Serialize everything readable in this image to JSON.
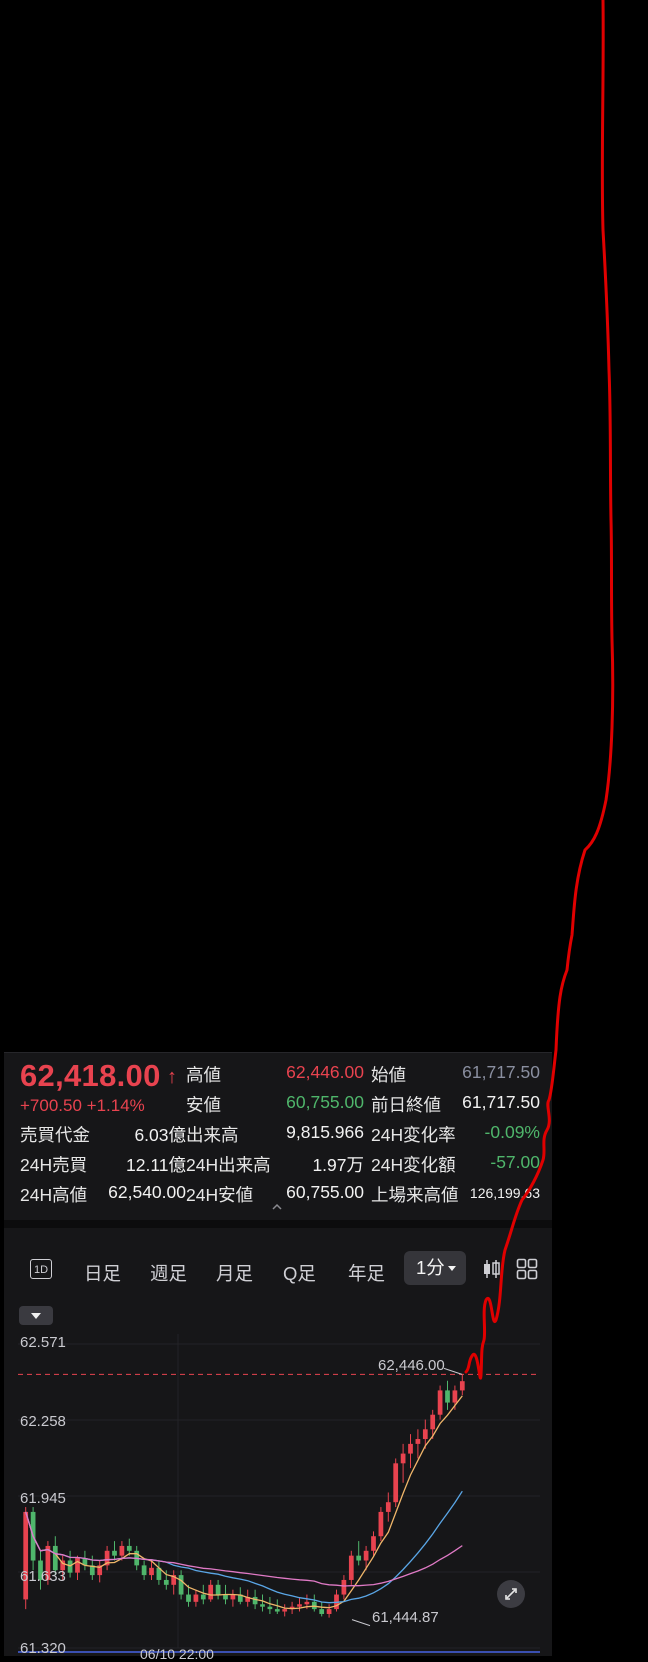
{
  "quote": {
    "price": "62,418.00",
    "change": "+700.50  +1.14%"
  },
  "stats": {
    "high_label": "高値",
    "high": "62,446.00",
    "open_label": "始値",
    "open": "61,717.50",
    "low_label": "安値",
    "low": "60,755.00",
    "prev_close_label": "前日終値",
    "prev_close": "61,717.50",
    "turnover_label": "売買代金",
    "turnover": "6.03億",
    "volume_label": "出来高",
    "volume": "9,815.966",
    "chg24_rate_label": "24H変化率",
    "chg24_rate": "-0.09%",
    "turnover24_label": "24H売買",
    "turnover24": "12.11億",
    "volume24_label": "24H出来高",
    "volume24": "1.97万",
    "chg24_amt_label": "24H変化額",
    "chg24_amt": "-57.00",
    "high24_label": "24H高値",
    "high24": "62,540.00",
    "low24_label": "24H安値",
    "low24": "60,755.00",
    "ath_label": "上場来高値",
    "ath": "126,199.63"
  },
  "tabs": {
    "tab_1d": "1D",
    "daily": "日足",
    "weekly": "週足",
    "monthly": "月足",
    "quarterly": "Q足",
    "yearly": "年足",
    "minute": "1分"
  },
  "icons": [
    "up-arrow-icon",
    "expand-chevron-icon",
    "candle-style-icon",
    "grid-layout-icon",
    "dropdown-caret-icon",
    "fullscreen-expand-icon"
  ],
  "colors": {
    "up": "#e8434f",
    "down": "#4fb66b",
    "background": "#161618",
    "annotation": "#e00000",
    "ma_short": "#f0b66a",
    "ma_mid": "#5aa6e6",
    "ma_long": "#e07ac6"
  },
  "chart_data": {
    "type": "candlestick",
    "interval": "1分",
    "y_ticks": [
      "62.571",
      "62.258",
      "61.945",
      "61.633",
      "61.320"
    ],
    "ylim": [
      61320,
      62571
    ],
    "x_tick_label": "06/10 22:00",
    "high_marker": "62,446.00",
    "low_marker": "61,444.87",
    "high_value": 62446,
    "low_value": 61444.87,
    "candles": [
      [
        61520,
        61900,
        61480,
        61880
      ],
      [
        61880,
        61900,
        61640,
        61680
      ],
      [
        61680,
        61720,
        61560,
        61600
      ],
      [
        61600,
        61760,
        61580,
        61740
      ],
      [
        61740,
        61780,
        61620,
        61640
      ],
      [
        61640,
        61700,
        61600,
        61680
      ],
      [
        61680,
        61720,
        61610,
        61630
      ],
      [
        61630,
        61700,
        61600,
        61690
      ],
      [
        61690,
        61720,
        61640,
        61660
      ],
      [
        61660,
        61700,
        61600,
        61620
      ],
      [
        61620,
        61680,
        61590,
        61660
      ],
      [
        61660,
        61740,
        61640,
        61720
      ],
      [
        61720,
        61760,
        61680,
        61700
      ],
      [
        61700,
        61760,
        61680,
        61740
      ],
      [
        61740,
        61770,
        61700,
        61720
      ],
      [
        61720,
        61740,
        61640,
        61660
      ],
      [
        61660,
        61680,
        61600,
        61620
      ],
      [
        61620,
        61680,
        61600,
        61650
      ],
      [
        61650,
        61680,
        61580,
        61600
      ],
      [
        61600,
        61640,
        61560,
        61580
      ],
      [
        61580,
        61640,
        61540,
        61620
      ],
      [
        61620,
        61640,
        61520,
        61540
      ],
      [
        61540,
        61580,
        61490,
        61510
      ],
      [
        61510,
        61560,
        61490,
        61540
      ],
      [
        61540,
        61580,
        61500,
        61520
      ],
      [
        61520,
        61600,
        61510,
        61580
      ],
      [
        61580,
        61600,
        61520,
        61540
      ],
      [
        61540,
        61580,
        61500,
        61520
      ],
      [
        61520,
        61560,
        61490,
        61540
      ],
      [
        61540,
        61570,
        61500,
        61510
      ],
      [
        61510,
        61560,
        61490,
        61530
      ],
      [
        61530,
        61560,
        61480,
        61500
      ],
      [
        61500,
        61540,
        61470,
        61490
      ],
      [
        61490,
        61530,
        61460,
        61480
      ],
      [
        61480,
        61520,
        61460,
        61470
      ],
      [
        61470,
        61500,
        61450,
        61480
      ],
      [
        61480,
        61510,
        61460,
        61490
      ],
      [
        61490,
        61530,
        61470,
        61500
      ],
      [
        61500,
        61540,
        61480,
        61510
      ],
      [
        61510,
        61540,
        61470,
        61480
      ],
      [
        61480,
        61510,
        61450,
        61460
      ],
      [
        61460,
        61500,
        61445,
        61480
      ],
      [
        61480,
        61560,
        61470,
        61540
      ],
      [
        61540,
        61620,
        61520,
        61600
      ],
      [
        61600,
        61720,
        61580,
        61700
      ],
      [
        61700,
        61760,
        61660,
        61680
      ],
      [
        61680,
        61740,
        61640,
        61720
      ],
      [
        61720,
        61800,
        61700,
        61780
      ],
      [
        61780,
        61900,
        61760,
        61880
      ],
      [
        61880,
        61960,
        61840,
        61920
      ],
      [
        61920,
        62100,
        61900,
        62080
      ],
      [
        62080,
        62160,
        62000,
        62120
      ],
      [
        62120,
        62200,
        62060,
        62160
      ],
      [
        62160,
        62220,
        62100,
        62180
      ],
      [
        62180,
        62260,
        62140,
        62220
      ],
      [
        62220,
        62300,
        62180,
        62280
      ],
      [
        62280,
        62400,
        62260,
        62380
      ],
      [
        62380,
        62420,
        62300,
        62330
      ],
      [
        62330,
        62400,
        62300,
        62380
      ],
      [
        62380,
        62446,
        62360,
        62418
      ]
    ]
  }
}
